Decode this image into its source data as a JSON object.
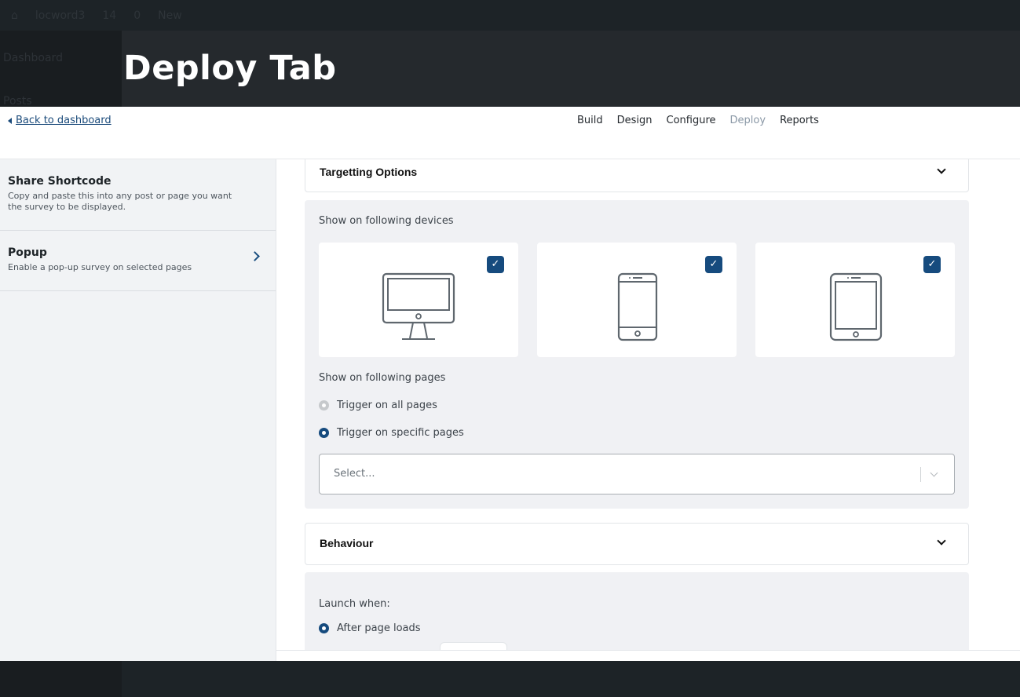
{
  "admin_bar": {
    "site": "locword3",
    "updates": "14",
    "comments": "0",
    "new": "New"
  },
  "wp_sidebar": {
    "items": [
      "Dashboard",
      "Posts"
    ]
  },
  "overlay": {
    "title": "Deploy Tab"
  },
  "topnav": {
    "back_label": "Back to dashboard",
    "tabs": [
      {
        "label": "Build"
      },
      {
        "label": "Design"
      },
      {
        "label": "Configure"
      },
      {
        "label": "Deploy",
        "active": true
      },
      {
        "label": "Reports"
      }
    ]
  },
  "sidebar": {
    "items": [
      {
        "title": "Share Shortcode",
        "desc": "Copy and paste this into any post or page you want the survey to be displayed."
      },
      {
        "title": "Popup",
        "desc": "Enable a pop-up survey on selected pages"
      }
    ]
  },
  "targeting": {
    "title": "Targetting Options",
    "devices_label": "Show on following devices",
    "devices": [
      {
        "icon": "desktop-icon",
        "checked": true
      },
      {
        "icon": "mobile-icon",
        "checked": true
      },
      {
        "icon": "tablet-icon",
        "checked": true
      }
    ],
    "check_glyph": "✓",
    "pages_label": "Show on following pages",
    "radio_all": "Trigger on all pages",
    "radio_specific": "Trigger on specific pages",
    "selected_radio": "specific",
    "select_placeholder": "Select..."
  },
  "behaviour": {
    "title": "Behaviour",
    "launch_label": "Launch when:",
    "radio_after_load": "After page loads"
  },
  "colors": {
    "accent": "#164b7e",
    "panel_bg": "#f0f1f4",
    "overlay": "#25292d"
  }
}
